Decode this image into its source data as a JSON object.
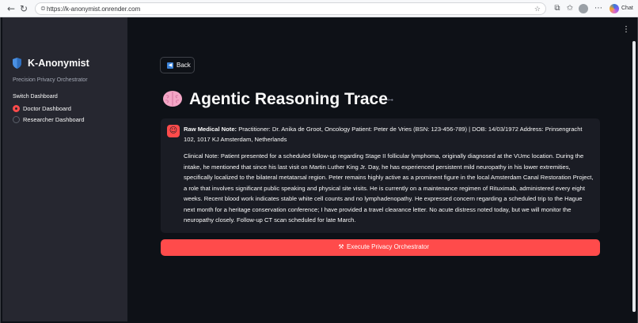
{
  "browser": {
    "url": "https://k-anonymist.onrender.com",
    "chat_label": "Chat",
    "icons": [
      "back-arrow-icon",
      "forward-arrow-icon",
      "reload-icon",
      "site-info-icon",
      "bookmark-star-icon",
      "extensions-icon",
      "favorites-icon",
      "profile-avatar",
      "more-menu-icon",
      "copilot-chat-icon"
    ]
  },
  "sidebar": {
    "brand_icon": "shield-icon",
    "app_name": "K-Anonymist",
    "tagline": "Precision Privacy Orchestrator",
    "switch_label": "Switch Dashboard",
    "options": [
      {
        "label": "Doctor Dashboard",
        "selected": true
      },
      {
        "label": "Researcher Dashboard",
        "selected": false
      }
    ]
  },
  "main": {
    "back_button": {
      "icon": "back-arrow-icon",
      "label": "Back"
    },
    "title_icon": "brain-icon",
    "title": "Agentic Reasoning Trace",
    "anchor_icon": "link-icon",
    "note": {
      "icon": "avatar-icon",
      "heading_label": "Raw Medical Note:",
      "heading_text": " Practitioner: Dr. Anika de Groot, Oncology Patient: Peter de Vries (BSN: 123-456-789) | DOB: 14/03/1972 Address: Prinsengracht 102, 1017 KJ Amsterdam, Netherlands",
      "body": "Clinical Note: Patient presented for a scheduled follow-up regarding Stage II follicular lymphoma, originally diagnosed at the VUmc location. During the intake, he mentioned that since his last visit on Martin Luther King Jr. Day, he has experienced persistent mild neuropathy in his lower extremities, specifically localized to the bilateral metatarsal region. Peter remains highly active as a prominent figure in the local Amsterdam Canal Restoration Project, a role that involves significant public speaking and physical site visits. He is currently on a maintenance regimen of Rituximab, administered every eight weeks. Recent blood work indicates stable white cell counts and no lymphadenopathy. He expressed concern regarding a scheduled trip to the Hague next month for a heritage conservation conference; I have provided a travel clearance letter. No acute distress noted today, but we will monitor the neuropathy closely. Follow-up CT scan scheduled for late March."
    },
    "execute_button": {
      "icon": "hammer-icon",
      "label": "Execute Privacy Orchestrator"
    }
  },
  "colors": {
    "accent": "#ff4b4b",
    "app_background": "#0e1117",
    "sidebar_background": "#262730",
    "card_background": "#1a1c24",
    "text": "#fafafa"
  }
}
